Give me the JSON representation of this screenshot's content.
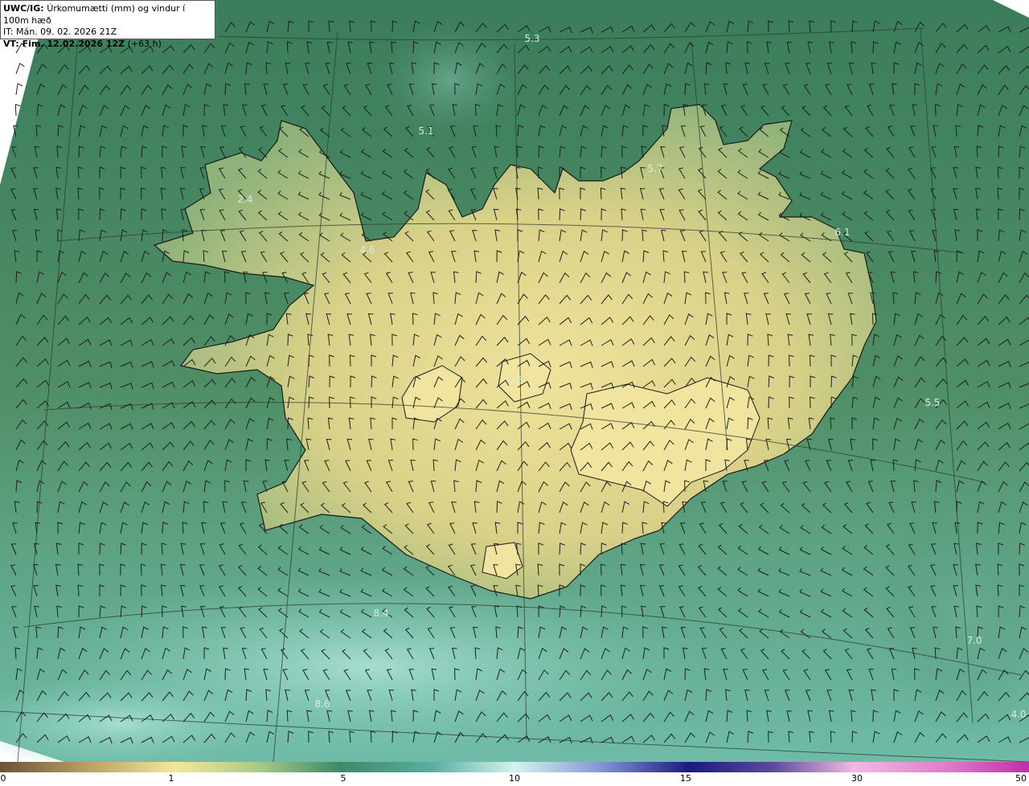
{
  "header": {
    "product": "UWC/IG:",
    "title": "Úrkomumætti (mm) og vindur í 100m hæð",
    "it_label": "IT:",
    "init_time": "Mán. 09. 02. 2026 21Z",
    "vt_label": "VT: Fim. 12.02.2026 12Z",
    "lead": "(+63 h)"
  },
  "map_labels": [
    {
      "text": "5.3"
    },
    {
      "text": "5.1"
    },
    {
      "text": "5.7"
    },
    {
      "text": "6.1"
    },
    {
      "text": "2.4"
    },
    {
      "text": "4.6"
    },
    {
      "text": "5.5"
    },
    {
      "text": "8.4"
    },
    {
      "text": "7.0"
    },
    {
      "text": "8.6"
    },
    {
      "text": "4.0"
    },
    {
      "text": "0.8"
    }
  ],
  "colorbar": {
    "unit": "mm",
    "ticks": [
      "0",
      "1",
      "5",
      "10",
      "15",
      "30",
      "50"
    ],
    "colors": {
      "dry": "#6b5335",
      "light": "#f3e79a",
      "medium": "#3d8a6a",
      "wet": "#d2f3ef",
      "heavy": "#1a1a80",
      "extreme": "#c12ea8"
    }
  },
  "map_colors": {
    "sea_green": "#3f7f5e",
    "land_yellow": "#e9dd8f",
    "south_cyan": "#8fd1c4",
    "coast": "#1a1a1a"
  }
}
